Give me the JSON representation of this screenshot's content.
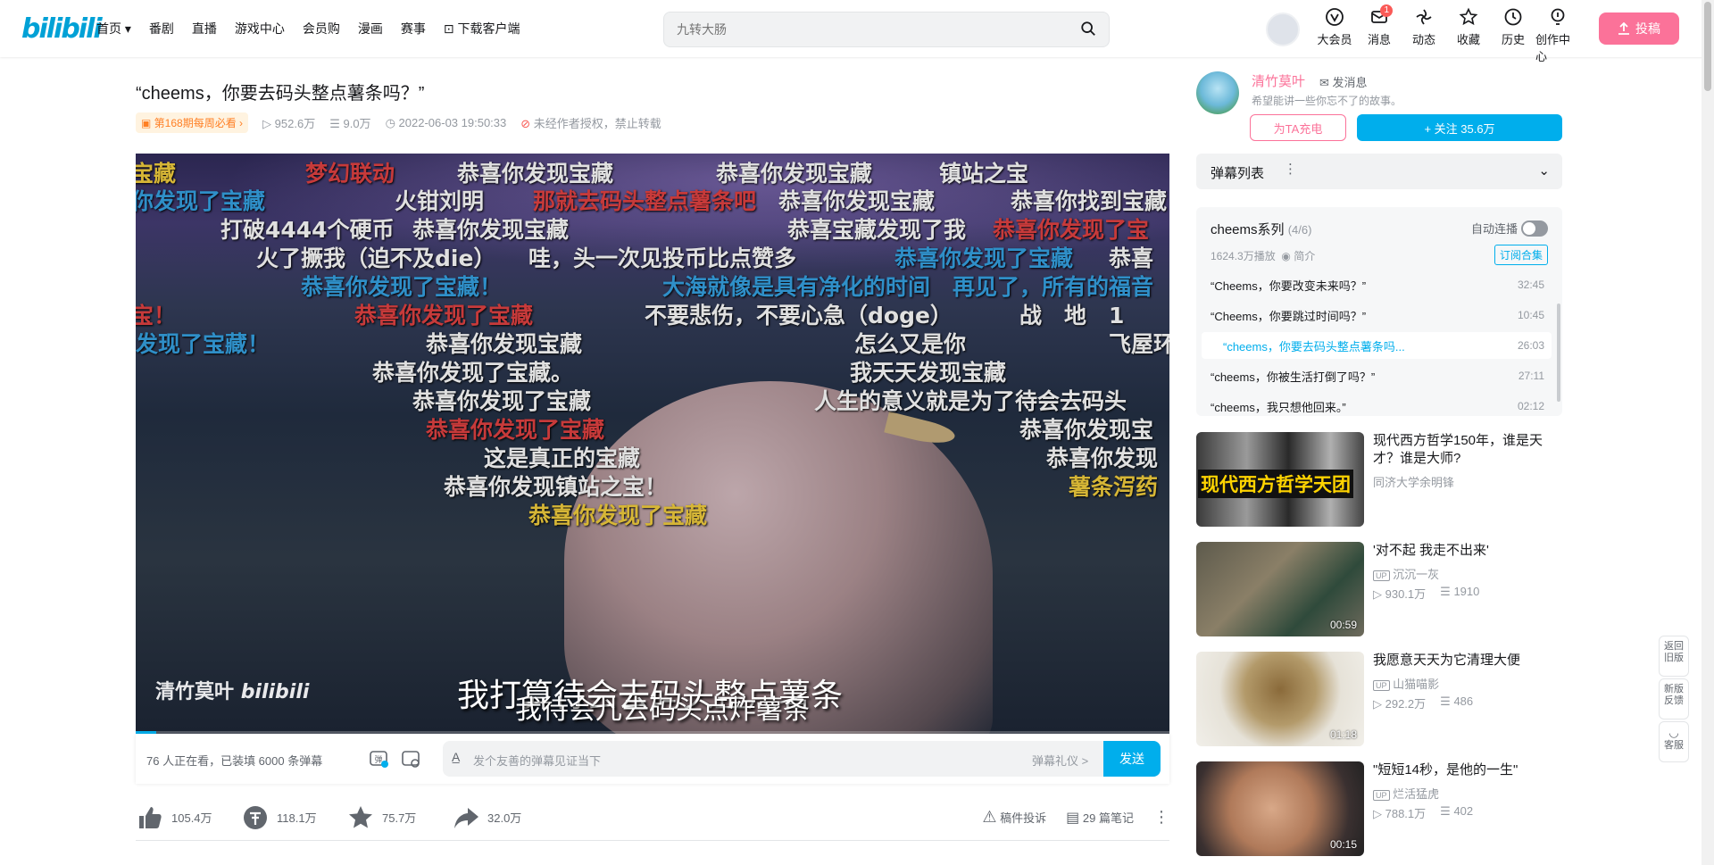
{
  "header": {
    "logo": "bilibili",
    "nav": [
      "首页",
      "番剧",
      "直播",
      "游戏中心",
      "会员购",
      "漫画",
      "赛事",
      "下载客户端"
    ],
    "search_placeholder": "九转大肠",
    "icons": [
      {
        "label": "大会员",
        "icon": "vip-icon"
      },
      {
        "label": "消息",
        "icon": "message-icon",
        "badge": "1"
      },
      {
        "label": "动态",
        "icon": "dynamic-icon"
      },
      {
        "label": "收藏",
        "icon": "favorite-icon"
      },
      {
        "label": "历史",
        "icon": "history-icon"
      },
      {
        "label": "创作中心",
        "icon": "creator-icon"
      }
    ],
    "upload": "投稿"
  },
  "video": {
    "title": "“cheems，你要去码头整点薯条吗？”",
    "weekly": "第168期每周必看",
    "views": "952.6万",
    "danmaku": "9.0万",
    "date": "2022-06-03 19:50:33",
    "copyright": "未经作者授权，禁止转载",
    "subtitle_1": "我打算待会去码头整点薯条",
    "subtitle_2": "我待会儿去码头点炸薯条",
    "watermark": "清竹莫叶",
    "progress": 0.02,
    "danmaku_items": [
      {
        "text": "宝藏",
        "color": "#d6b636"
      },
      {
        "text": "梦幻联动",
        "color": "#c73a3a"
      },
      {
        "text": "恭喜你发现宝藏",
        "color": "#e0e0e0"
      },
      {
        "text": "恭喜你发现宝藏",
        "color": "#e0e0e0"
      },
      {
        "text": "镇站之宝",
        "color": "#e0e0e0"
      },
      {
        "text": "你发现了宝藏",
        "color": "#2f8fc8"
      },
      {
        "text": "火钳刘明",
        "color": "#e0e0e0"
      },
      {
        "text": "那就去码头整点薯条吧",
        "color": "#c73a3a"
      },
      {
        "text": "恭喜你发现宝藏",
        "color": "#e0e0e0"
      },
      {
        "text": "恭喜你找到宝藏",
        "color": "#e0e0e0"
      },
      {
        "text": "打破4444个硬币",
        "color": "#e0e0e0"
      },
      {
        "text": "恭喜你发现宝藏",
        "color": "#e0e0e0"
      },
      {
        "text": "恭喜宝藏发现了我",
        "color": "#e0e0e0"
      },
      {
        "text": "恭喜你发现了宝",
        "color": "#c73a3a"
      },
      {
        "text": "火了撅我（迫不及die）",
        "color": "#e0e0e0"
      },
      {
        "text": "哇，头一次见投币比点赞多",
        "color": "#e0e0e0"
      },
      {
        "text": "恭喜你发现了宝藏",
        "color": "#2f8fc8"
      },
      {
        "text": "恭喜",
        "color": "#e0e0e0"
      },
      {
        "text": "恭喜你发现了宝藏！",
        "color": "#2f8fc8"
      },
      {
        "text": "大海就像是具有净化的时间",
        "color": "#2f8fc8"
      },
      {
        "text": "再见了，所有的福音",
        "color": "#2f8fc8"
      },
      {
        "text": "宝！",
        "color": "#c73a3a"
      },
      {
        "text": "恭喜你发现了宝藏",
        "color": "#c73a3a"
      },
      {
        "text": "不要悲伤，不要心急（doge）",
        "color": "#e0e0e0"
      },
      {
        "text": "战　地　1",
        "color": "#e0e0e0"
      },
      {
        "text": "发现了宝藏！",
        "color": "#2f8fc8"
      },
      {
        "text": "恭喜你发现宝藏",
        "color": "#e0e0e0"
      },
      {
        "text": "怎么又是你",
        "color": "#e0e0e0"
      },
      {
        "text": "飞屋环",
        "color": "#e0e0e0"
      },
      {
        "text": "恭喜你发现了宝藏。",
        "color": "#e0e0e0"
      },
      {
        "text": "我天天发现宝藏",
        "color": "#e0e0e0"
      },
      {
        "text": "恭喜你发现了宝藏",
        "color": "#e0e0e0"
      },
      {
        "text": "人生的意义就是为了待会去码头",
        "color": "#e0e0e0"
      },
      {
        "text": "恭喜你发现了宝藏",
        "color": "#c73a3a"
      },
      {
        "text": "恭喜你发现宝",
        "color": "#e0e0e0"
      },
      {
        "text": "这是真正的宝藏",
        "color": "#e0e0e0"
      },
      {
        "text": "恭喜你发现",
        "color": "#e0e0e0"
      },
      {
        "text": "恭喜你发现镇站之宝！",
        "color": "#e0e0e0"
      },
      {
        "text": "薯条泻药",
        "color": "#d6b636"
      },
      {
        "text": "恭喜你发现了宝藏",
        "color": "#d6b636"
      }
    ]
  },
  "send_bar": {
    "info": "76 人正在看，已装填 6000 条弹幕",
    "placeholder": "发个友善的弹幕见证当下",
    "etiquette": "弹幕礼仪 >",
    "send": "发送"
  },
  "toolbar": {
    "like": "105.4万",
    "coin": "118.1万",
    "fav": "75.7万",
    "share": "32.0万",
    "report": "稿件投诉",
    "notes": "29 篇笔记"
  },
  "up": {
    "name": "清竹莫叶",
    "msg": "发消息",
    "desc": "希望能讲一些你忘不了的故事。",
    "charge": "为TA充电",
    "follow": "+ 关注 35.6万"
  },
  "danmaku_list": {
    "title": "弹幕列表"
  },
  "series": {
    "title": "cheems系列",
    "count": "(4/6)",
    "auto": "自动连播",
    "stats": "1624.3万播放",
    "intro": "简介",
    "subscribe": "订阅合集",
    "episodes": [
      {
        "title": "“Cheems，你要改变未来吗？”",
        "dur": "32:45",
        "active": false
      },
      {
        "title": "“Cheems，你要跳过时间吗？”",
        "dur": "10:45",
        "active": false
      },
      {
        "title": "“cheems，你要去码头整点薯条吗...",
        "dur": "26:03",
        "active": true
      },
      {
        "title": "“cheems，你被生活打倒了吗？”",
        "dur": "27:11",
        "active": false
      },
      {
        "title": "“cheems，我只想他回来。”",
        "dur": "02:12",
        "active": false
      }
    ]
  },
  "recommend": [
    {
      "title": "现代西方哲学150年，谁是天才？谁是大师?",
      "author": "同济大学余明锋",
      "thumb_text": "现代西方哲学天团",
      "dur": "",
      "plays": "",
      "dm": ""
    },
    {
      "title": "'对不起 我走不出来'",
      "author": "沉沉一灰",
      "dur": "00:59",
      "plays": "930.1万",
      "dm": "1910"
    },
    {
      "title": "我愿意天天为它清理大便",
      "author": "山猫喵影",
      "dur": "01:18",
      "plays": "292.2万",
      "dm": "486"
    },
    {
      "title": "\"短短14秒，是他的一生\"",
      "author": "烂活猛虎",
      "dur": "00:15",
      "plays": "788.1万",
      "dm": "402"
    }
  ],
  "float": {
    "back": "返回旧版",
    "feedback": "新版反馈",
    "service": "客服"
  }
}
